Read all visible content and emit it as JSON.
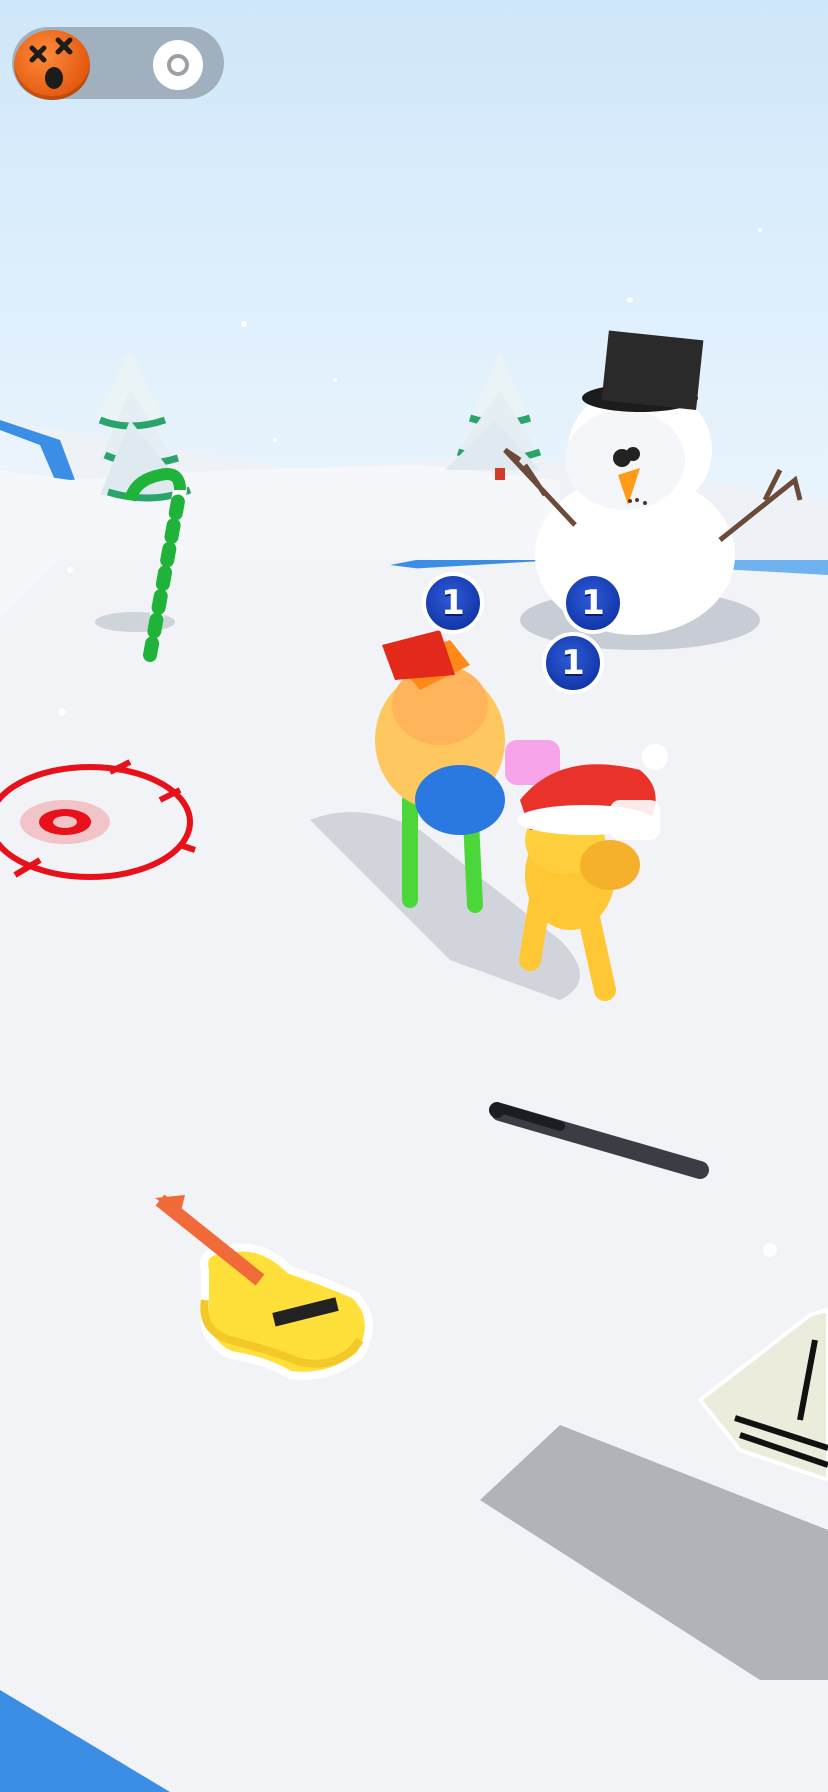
{
  "scene": {
    "name": "winter-arena",
    "sky_color": "#d7ecfb",
    "snow_color": "#f2f3f7",
    "ice_color": "#3a8ee6"
  },
  "hud": {
    "player_face_icon": "dizzy-face-icon",
    "toggle_icon": "ring-toggle-icon"
  },
  "hit_counters": [
    {
      "label": "1"
    },
    {
      "label": "1"
    },
    {
      "label": "1"
    }
  ],
  "objects": [
    "snowman",
    "christmas-tree-left",
    "christmas-tree-right",
    "candy-cane-pole",
    "target-marker",
    "baseball-bat",
    "guitar",
    "table",
    "brawlers"
  ]
}
